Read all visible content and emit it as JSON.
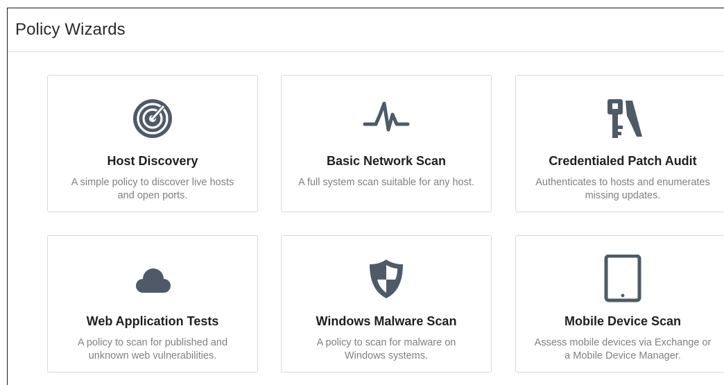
{
  "header": {
    "title": "Policy Wizards"
  },
  "colors": {
    "icon": "#4f5a68",
    "card_border": "#d9d9d9",
    "desc_text": "#808080"
  },
  "wizards": [
    {
      "title": "Host Discovery",
      "description": "A simple policy to discover live hosts and open ports.",
      "icon": "radar-target-icon"
    },
    {
      "title": "Basic Network Scan",
      "description": "A full system scan suitable for any host.",
      "icon": "pulse-waveform-icon"
    },
    {
      "title": "Credentialed Patch Audit",
      "description": "Authenticates to hosts and enumerates missing updates.",
      "icon": "key-icon"
    },
    {
      "title": "Web Application Tests",
      "description": "A policy to scan for published and unknown web vulnerabilities.",
      "icon": "cloud-icon"
    },
    {
      "title": "Windows Malware Scan",
      "description": "A policy to scan for malware on Windows systems.",
      "icon": "shield-icon"
    },
    {
      "title": "Mobile Device Scan",
      "description": "Assess mobile devices via Exchange or a Mobile Device Manager.",
      "icon": "tablet-icon"
    }
  ]
}
